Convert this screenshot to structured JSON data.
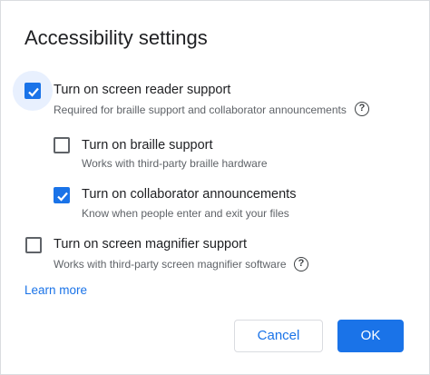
{
  "dialog": {
    "title": "Accessibility settings",
    "options": [
      {
        "label": "Turn on screen reader support",
        "description": "Required for braille support and collaborator announcements",
        "checked": true,
        "help_icon": "help-circle-icon"
      },
      {
        "label": "Turn on braille support",
        "description": "Works with third-party braille hardware",
        "checked": false
      },
      {
        "label": "Turn on collaborator announcements",
        "description": "Know when people enter and exit your files",
        "checked": true
      },
      {
        "label": "Turn on screen magnifier support",
        "description": "Works with third-party screen magnifier software",
        "checked": false,
        "help_icon": "help-circle-icon"
      }
    ],
    "learn_more": "Learn more",
    "cancel_label": "Cancel",
    "ok_label": "OK",
    "help_glyph": "?"
  },
  "colors": {
    "accent": "#1a73e8",
    "text_primary": "#202124",
    "text_secondary": "#5f6368",
    "border": "#dadce0",
    "focus_halo": "#e8f0fe"
  }
}
